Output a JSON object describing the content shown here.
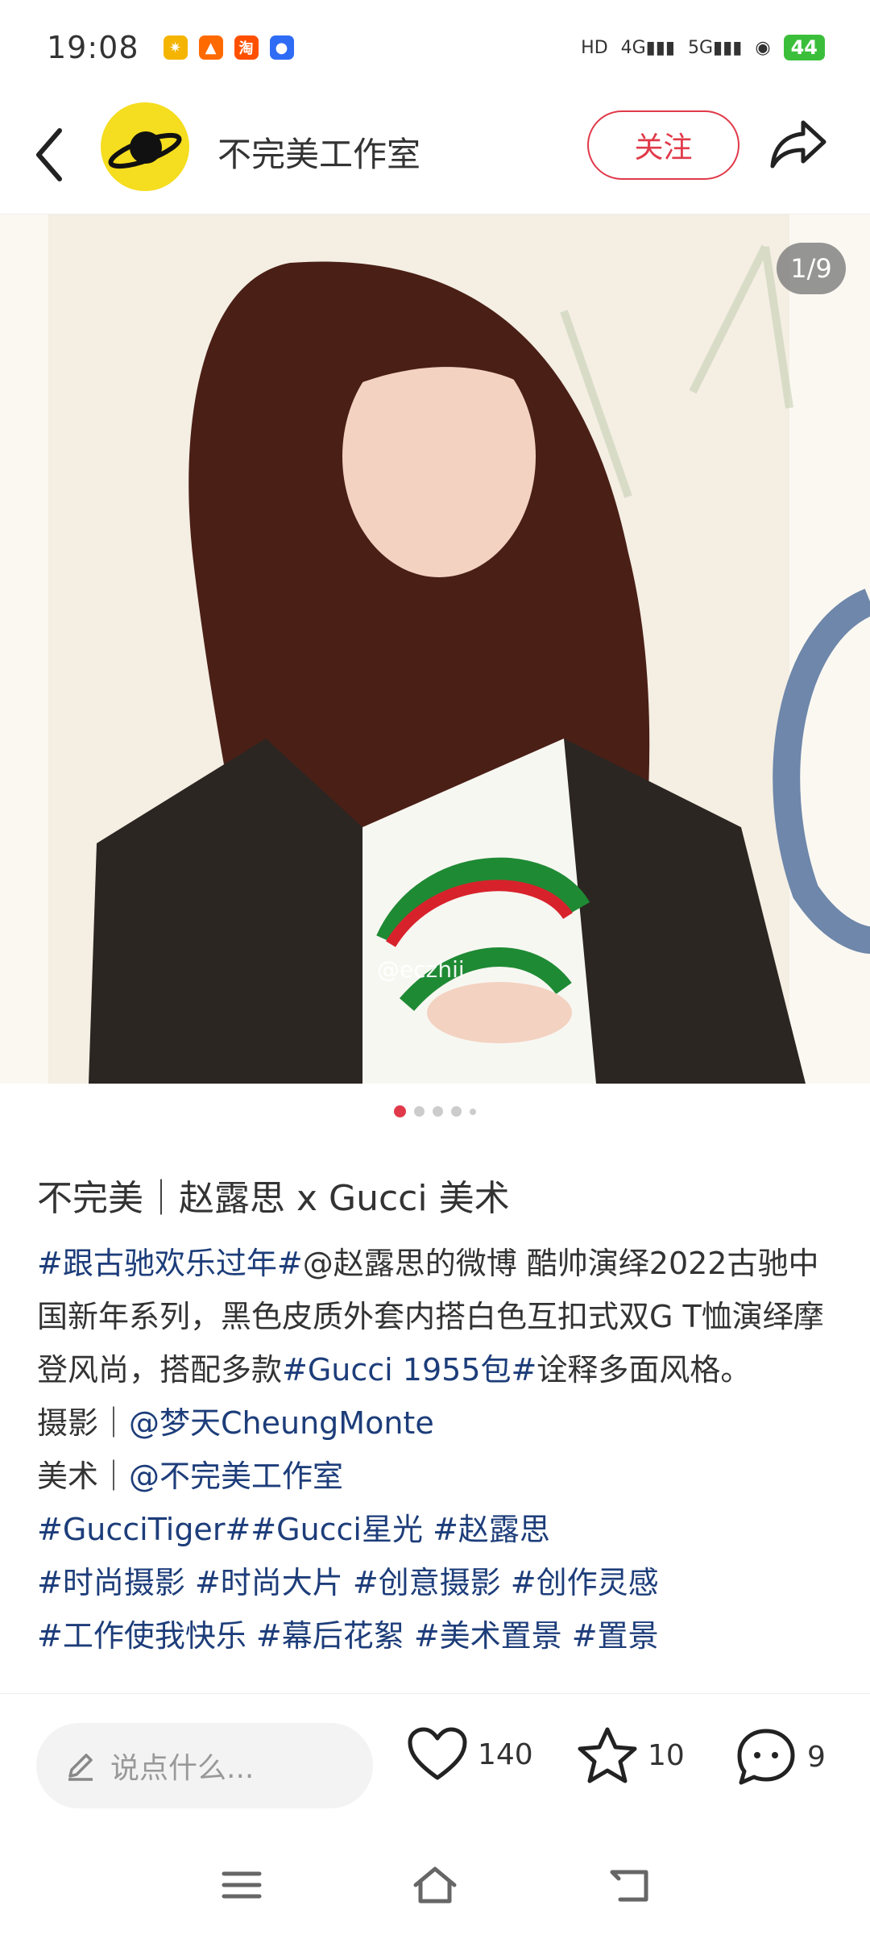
{
  "status": {
    "time": "19:08",
    "battery": "44",
    "network": [
      "HD",
      "4G",
      "5G"
    ]
  },
  "header": {
    "account_name": "不完美工作室",
    "follow_label": "关注"
  },
  "photo": {
    "counter": "1/9",
    "watermark": "@eczhii"
  },
  "post": {
    "title": "不完美｜赵露思 x Gucci 美术",
    "body_tag_1": "#跟古驰欢乐过年#",
    "body_text_1": "@赵露思的微博 酷帅演绎2022古驰中国新年系列，黑色皮质外套内搭白色互扣式双G T恤演绎摩登风尚，搭配多款",
    "body_tag_2": "#Gucci 1955包#",
    "body_tag_3": "诠释多面风格。",
    "credit_photo_label": "摄影｜",
    "credit_photo_name": "@梦天CheungMonte",
    "credit_art_label": "美术｜",
    "credit_art_name": "@不完美工作室",
    "tags_line_1": "#GucciTiger##Gucci星光 #赵露思",
    "tags_line_2": "#时尚摄影 #时尚大片 #创意摄影 #创作灵感",
    "tags_line_3": "#工作使我快乐 #幕后花絮 #美术置景 #置景"
  },
  "bottom": {
    "comment_placeholder": "说点什么...",
    "likes": "140",
    "favorites": "10",
    "comments": "9"
  },
  "colors": {
    "accent": "#e03a4a",
    "tag": "#1d3d7a",
    "avatar": "#f5dd1f"
  }
}
